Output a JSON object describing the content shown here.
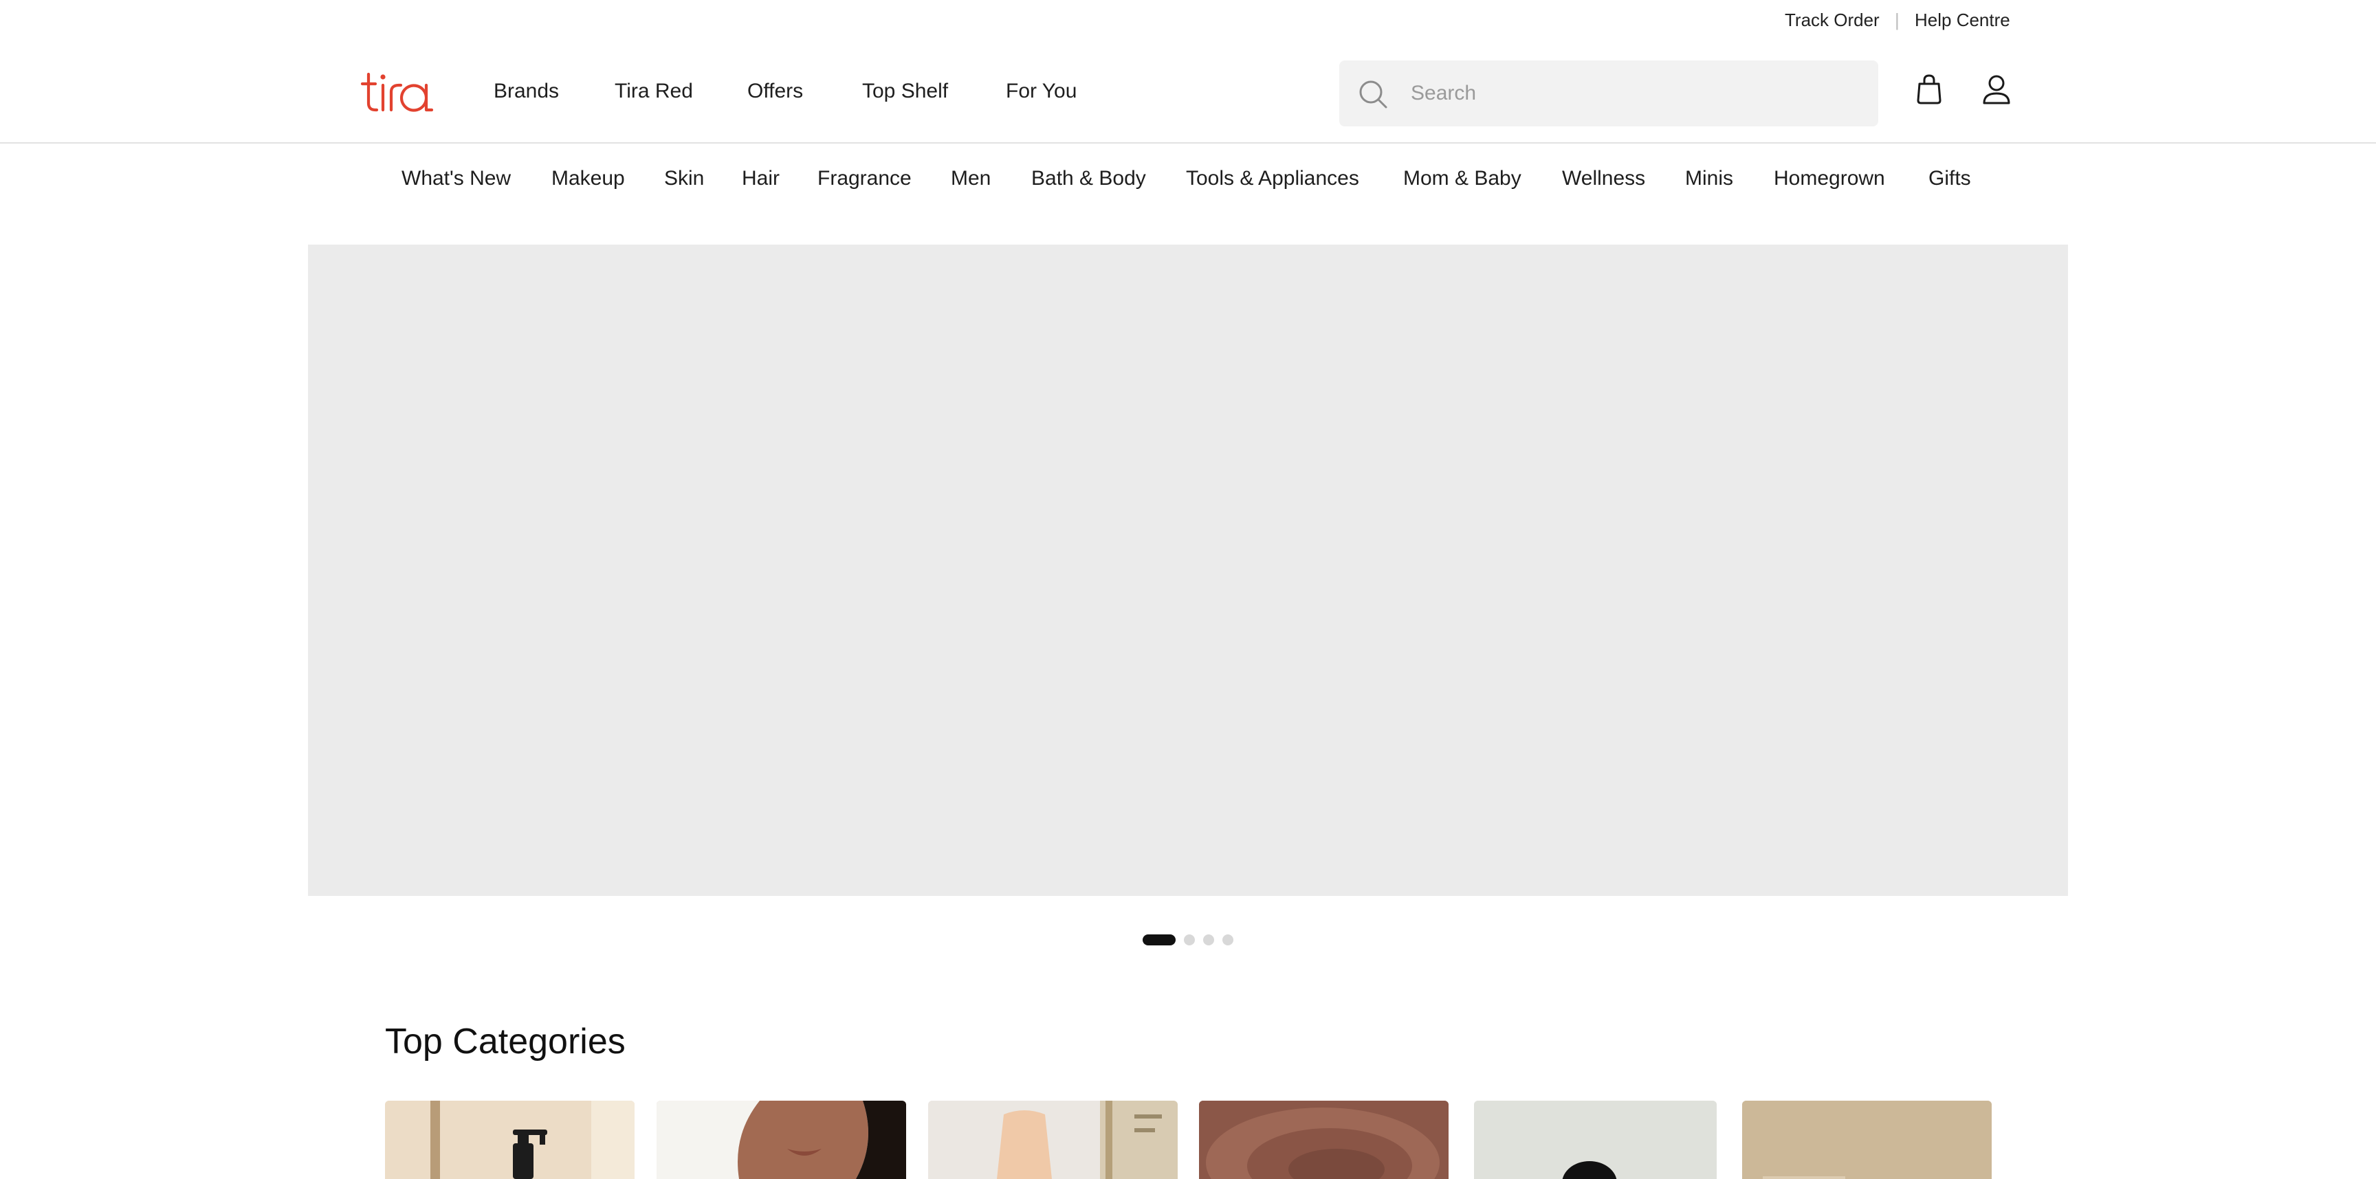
{
  "utility": {
    "track_order": "Track Order",
    "separator": "|",
    "help_centre": "Help Centre"
  },
  "header": {
    "logo_text": "tira",
    "brand_color": "#e2422f",
    "nav": [
      "Brands",
      "Tira Red",
      "Offers",
      "Top Shelf",
      "For You"
    ],
    "search": {
      "placeholder": "Search",
      "value": "",
      "icon": "search-icon"
    },
    "icons": [
      "bag-icon",
      "user-icon"
    ]
  },
  "categories_nav": [
    "What's New",
    "Makeup",
    "Skin",
    "Hair",
    "Fragrance",
    "Men",
    "Bath & Body",
    "Tools & Appliances",
    "Mom & Baby",
    "Wellness",
    "Minis",
    "Homegrown",
    "Gifts"
  ],
  "hero": {
    "slide_count": 4,
    "active_slide": 1
  },
  "top_categories": {
    "title": "Top Categories",
    "cards": [
      {
        "image": "pump-bottle-product"
      },
      {
        "image": "woman-portrait"
      },
      {
        "image": "cream-tube-product"
      },
      {
        "image": "powder-texture"
      },
      {
        "image": "dark-jar-product"
      },
      {
        "image": "beige-product"
      }
    ]
  }
}
